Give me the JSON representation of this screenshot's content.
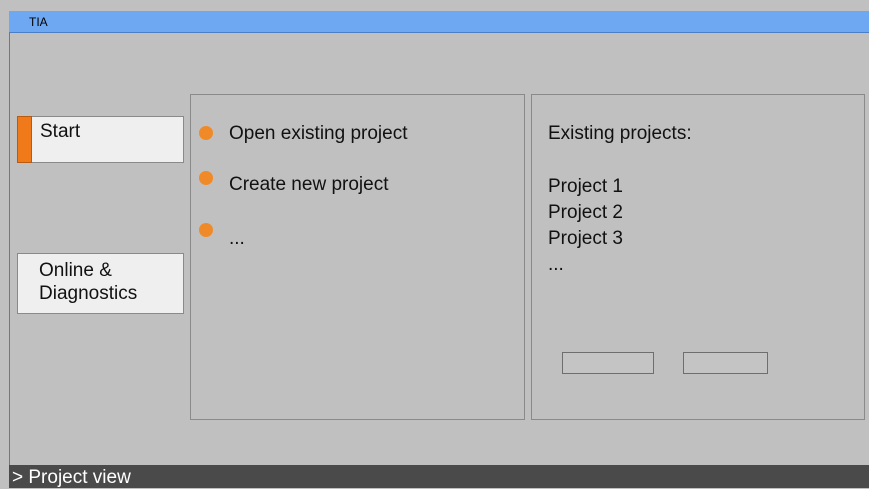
{
  "window": {
    "title": "TIA"
  },
  "nav": {
    "start_label": "Start",
    "online_label": "Online &\nDiagnostics"
  },
  "actions": [
    {
      "label": "Open existing project",
      "icon": "orange-bullet-icon"
    },
    {
      "label": "Create new project",
      "icon": "orange-bullet-icon"
    },
    {
      "label": "...",
      "icon": "orange-bullet-icon"
    }
  ],
  "projects": {
    "heading": "Existing projects:",
    "items": [
      "Project 1",
      "Project 2",
      "Project 3",
      "..."
    ]
  },
  "footer": {
    "label": "> Project view"
  },
  "colors": {
    "title_bar": "#6fa8f2",
    "accent": "#f07a1a",
    "background": "#c0c0c0",
    "footer": "#4a4a4a"
  }
}
